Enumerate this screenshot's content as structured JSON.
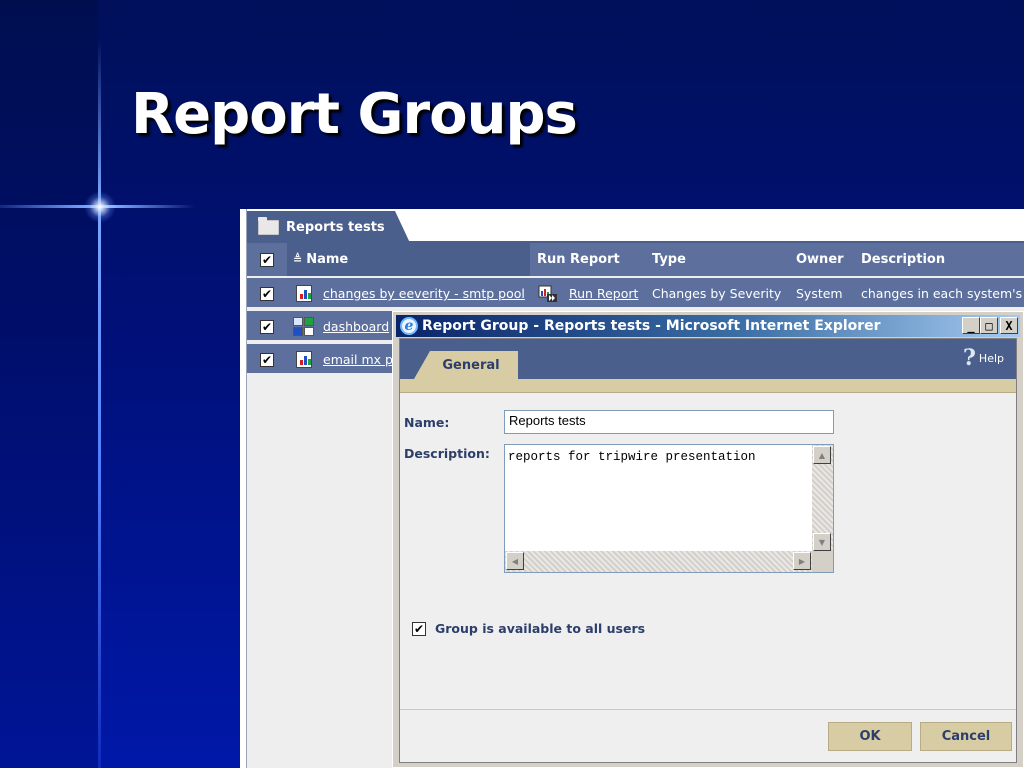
{
  "slide": {
    "title": "Report Groups"
  },
  "group_tab": {
    "label": "Reports tests",
    "icon": "folder-icon"
  },
  "grid": {
    "headers": {
      "name": "Name",
      "run_report": "Run Report",
      "type": "Type",
      "owner": "Owner",
      "description": "Description"
    },
    "sort_icon": "sort-ascending-icon",
    "rows": [
      {
        "name": "changes by eeverity - smtp pool",
        "run_report": "Run Report",
        "type": "Changes by Severity",
        "owner": "System",
        "description": "changes in each system's",
        "icon": "report-icon"
      },
      {
        "name": "dashboard",
        "icon": "dashboard-icon"
      },
      {
        "name": "email mx po",
        "icon": "report-icon"
      }
    ]
  },
  "dialog": {
    "title": "Report Group - Reports tests - Microsoft Internet Explorer",
    "window_buttons": {
      "minimize": "_",
      "maximize": "□",
      "close": "X"
    },
    "tab": "General",
    "help": "Help",
    "name_label": "Name:",
    "name_value": "Reports tests",
    "description_label": "Description:",
    "description_value": "reports for tripwire presentation",
    "checkbox_label": "Group is available to all users",
    "checkbox_checked": true,
    "ok": "OK",
    "cancel": "Cancel"
  },
  "colors": {
    "slide_bg": "#001079",
    "header_blue": "#5c6f9d",
    "tab_blue": "#4b5f8d",
    "tan": "#d8cca4",
    "label_text": "#2c3e6a"
  }
}
